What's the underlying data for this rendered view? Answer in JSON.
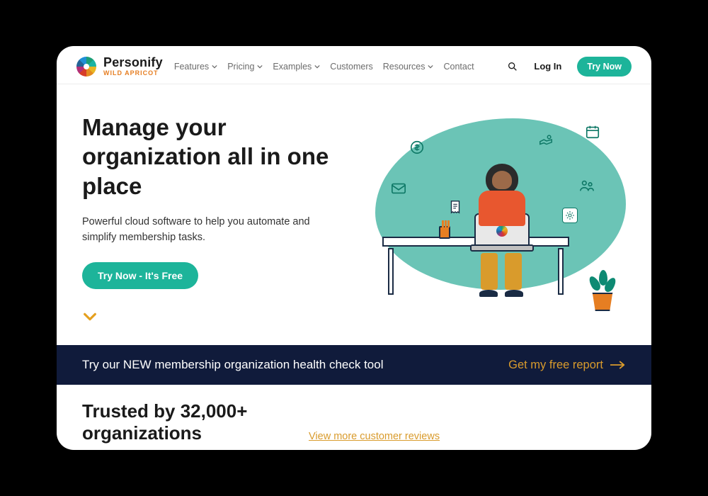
{
  "brand": {
    "main": "Personify",
    "sub": "WILD APRICOT"
  },
  "nav": {
    "items": [
      {
        "label": "Features",
        "dropdown": true
      },
      {
        "label": "Pricing",
        "dropdown": true
      },
      {
        "label": "Examples",
        "dropdown": true
      },
      {
        "label": "Customers",
        "dropdown": false
      },
      {
        "label": "Resources",
        "dropdown": true
      },
      {
        "label": "Contact",
        "dropdown": false
      }
    ],
    "login": "Log In",
    "try_now": "Try Now"
  },
  "hero": {
    "title": "Manage your organization all in one place",
    "subtitle": "Powerful cloud software to help you automate and simplify membership tasks.",
    "cta": "Try Now - It's Free"
  },
  "banner": {
    "text": "Try our NEW membership organization health check tool",
    "cta": "Get my free report"
  },
  "trusted": {
    "title": "Trusted by 32,000+ organizations",
    "link": "View more customer reviews"
  },
  "colors": {
    "accent_teal": "#1db49a",
    "accent_gold": "#d99b2c",
    "banner_bg": "#101b3b",
    "brand_orange": "#e67e22"
  },
  "icons": {
    "search": "search-icon",
    "chevron_down": "chevron-down-icon",
    "arrow_right": "arrow-right-icon",
    "mail": "mail-icon",
    "dollar": "dollar-icon",
    "hand": "hand-icon",
    "calendar": "calendar-icon",
    "people": "people-icon",
    "gear": "gear-icon",
    "receipt": "receipt-icon"
  }
}
